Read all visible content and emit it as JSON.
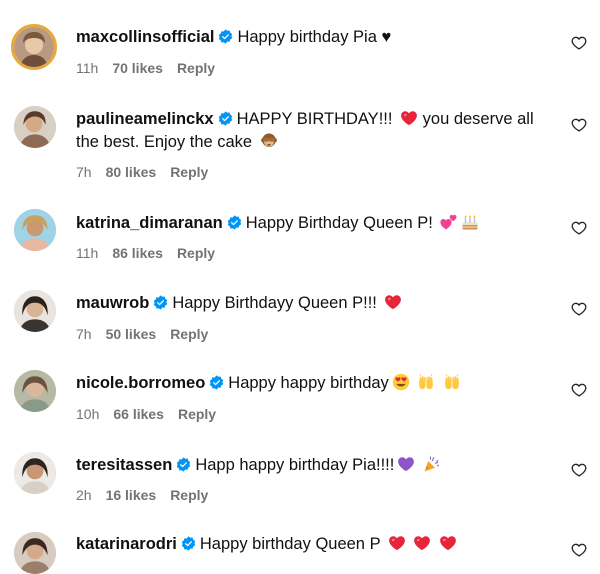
{
  "comments": [
    {
      "username": "maxcollinsofficial",
      "text": "Happy birthday Pia ♥",
      "time": "11h",
      "likes": "70 likes",
      "reply": "Reply",
      "emojis": []
    },
    {
      "username": "paulineamelinckx",
      "text_line1": "HAPPY BIRTHDAY!!!",
      "text_line1b": "you deserve all",
      "text_line2": "the best. Enjoy the cake",
      "time": "7h",
      "likes": "80 likes",
      "reply": "Reply",
      "emojis": [
        "red-heart",
        "see-no-evil-monkey"
      ]
    },
    {
      "username": "katrina_dimaranan",
      "text": "Happy Birthday Queen P!",
      "time": "11h",
      "likes": "86 likes",
      "reply": "Reply",
      "emojis": [
        "two-hearts",
        "birthday-cake"
      ]
    },
    {
      "username": "mauwrob",
      "text": "Happy Birthdayy Queen P!!!",
      "time": "7h",
      "likes": "50 likes",
      "reply": "Reply",
      "emojis": [
        "red-heart"
      ]
    },
    {
      "username": "nicole.borromeo",
      "text": "Happy happy birthday",
      "time": "10h",
      "likes": "66 likes",
      "reply": "Reply",
      "emojis": [
        "heart-eyes",
        "raising-hands",
        "raising-hands"
      ]
    },
    {
      "username": "teresitassen",
      "text": "Happ happy birthday Pia!!!!",
      "time": "2h",
      "likes": "16 likes",
      "reply": "Reply",
      "emojis": [
        "purple-heart",
        "party-popper"
      ]
    },
    {
      "username": "katarinarodri",
      "text": "Happy birthday Queen P",
      "emojis": [
        "red-heart",
        "red-heart",
        "red-heart"
      ]
    }
  ],
  "colors": {
    "verified": "#0095f6",
    "meta": "#737373",
    "heart": "#e8243b",
    "story_ring": "#e9a83a"
  },
  "icons": {
    "like": "heart-outline-icon",
    "verified": "verified-badge-icon"
  }
}
